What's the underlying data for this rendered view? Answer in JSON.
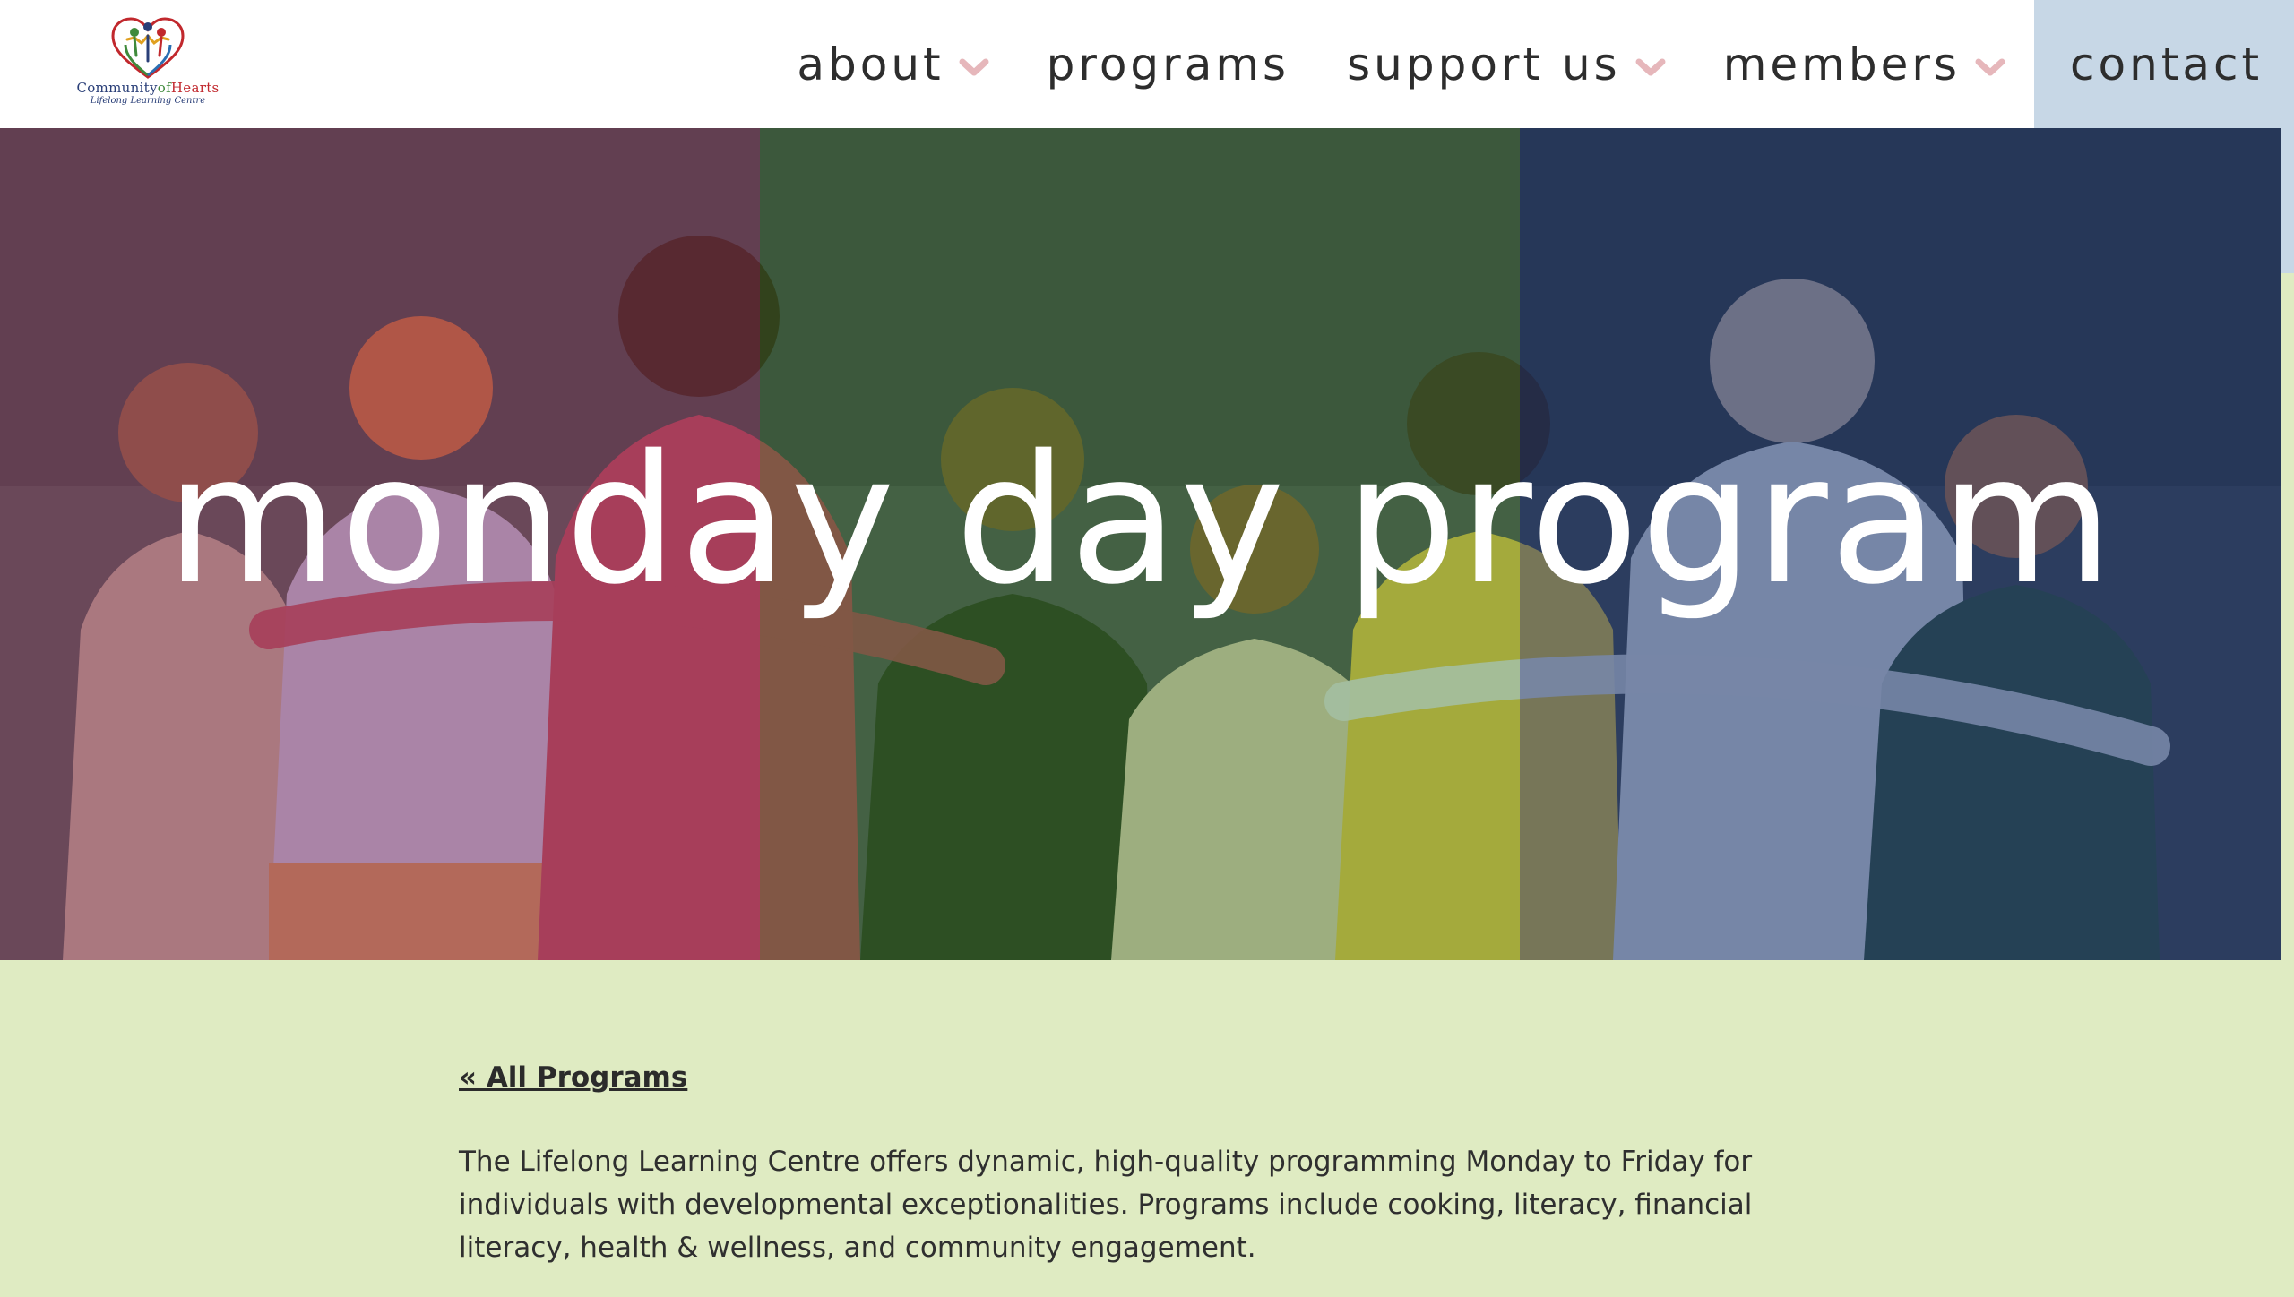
{
  "header": {
    "logo": {
      "word_community": "Community",
      "word_of": "of",
      "word_hearts": "Hearts",
      "tagline": "Lifelong Learning Centre"
    },
    "nav": [
      {
        "label": "about",
        "has_dropdown": true
      },
      {
        "label": "programs",
        "has_dropdown": false
      },
      {
        "label": "support us",
        "has_dropdown": true
      },
      {
        "label": "members",
        "has_dropdown": true
      },
      {
        "label": "contact",
        "has_dropdown": false
      }
    ],
    "chevron_color": "#e6b7bb",
    "contact_highlight_color": "#c7d7e6"
  },
  "hero": {
    "title": "monday day program"
  },
  "content": {
    "back_link": "« All Programs",
    "intro": "The Lifelong Learning Centre offers dynamic, high-quality programming Monday to Friday for individuals with developmental exceptionalities. Programs include cooking, literacy, financial literacy, health & wellness, and community engagement."
  },
  "colors": {
    "page_background": "#dfebc2",
    "header_background": "#ffffff",
    "tint_purple": "#963c5a",
    "tint_green": "#3c7828",
    "tint_navy": "#142d64"
  }
}
